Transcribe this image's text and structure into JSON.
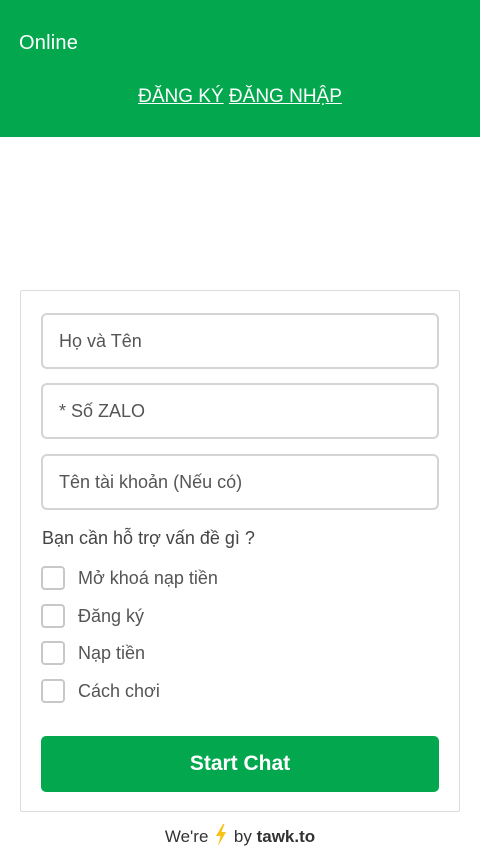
{
  "header": {
    "status": "Online",
    "register_link": "ĐĂNG KÝ",
    "login_link": "ĐĂNG NHẬP",
    "background_color": "#03a84e"
  },
  "form": {
    "name_placeholder": "Họ và Tên",
    "zalo_placeholder": "* Số ZALO",
    "account_placeholder": "Tên tài khoản (Nếu có)",
    "question": "Bạn cần hỗ trợ vấn đề gì ?",
    "options": [
      {
        "label": "Mở khoá nạp tiền",
        "checked": false
      },
      {
        "label": "Đăng ký",
        "checked": false
      },
      {
        "label": "Nạp tiền",
        "checked": false
      },
      {
        "label": "Cách chơi",
        "checked": false
      }
    ],
    "submit_label": "Start Chat",
    "accent_color": "#03a84e"
  },
  "footer": {
    "prefix": "We're",
    "by": "by",
    "brand": "tawk.to",
    "bolt_icon": "lightning-bolt-icon",
    "bolt_color": "#f6c216"
  }
}
